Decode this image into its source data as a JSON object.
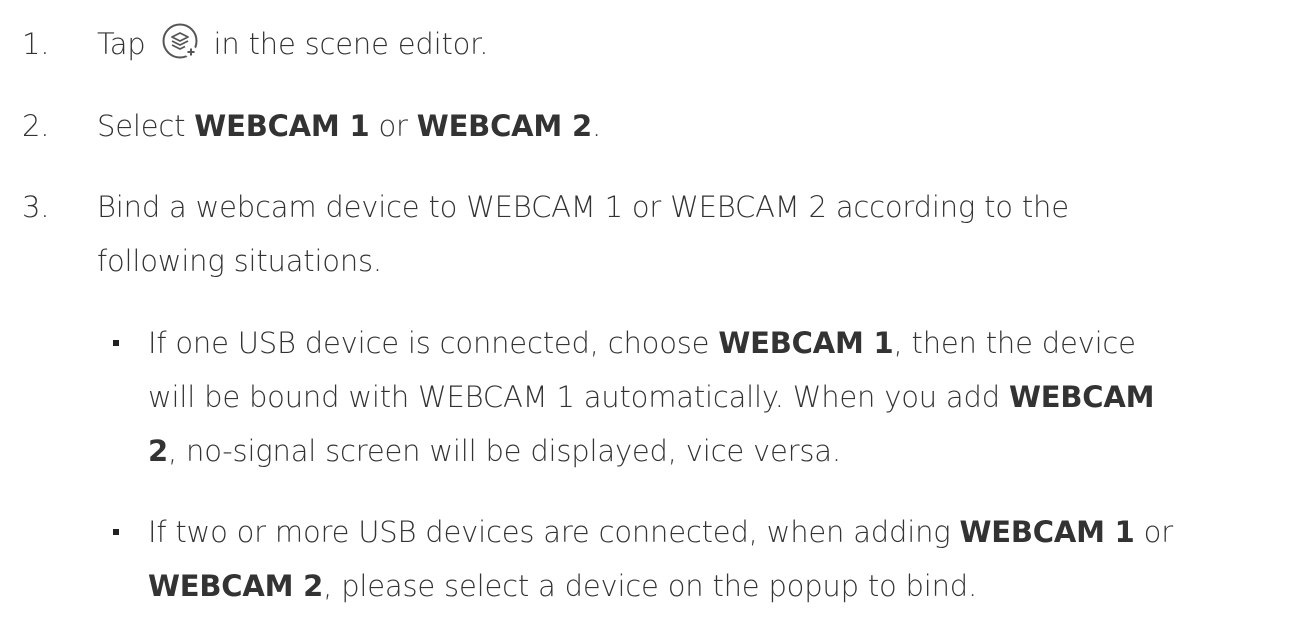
{
  "steps": [
    {
      "num": "1.",
      "pre": "Tap ",
      "icon": "add-layer-icon",
      "post": " in the scene editor."
    },
    {
      "num": "2.",
      "pre": "Select ",
      "b1": "WEBCAM 1",
      "mid": " or ",
      "b2": "WEBCAM 2",
      "post": "."
    },
    {
      "num": "3.",
      "line1": "Bind a webcam device to WEBCAM 1 or WEBCAM 2 according to the",
      "line2": "following situations."
    }
  ],
  "bullets": [
    {
      "l1_a": "If one USB device is connected, choose ",
      "l1_b": "WEBCAM 1",
      "l1_c": ", then the device",
      "l2_a": "will be bound with WEBCAM 1 automatically. When you add ",
      "l2_b": "WEBCAM",
      "l3_a": "2",
      "l3_b": ", no-signal screen will be displayed, vice versa."
    },
    {
      "l1_a": "If two or more USB devices are connected, when adding ",
      "l1_b": "WEBCAM 1",
      "l1_c": " or",
      "l2_a": "WEBCAM 2",
      "l2_b": ", please select a device on the popup to bind."
    }
  ]
}
